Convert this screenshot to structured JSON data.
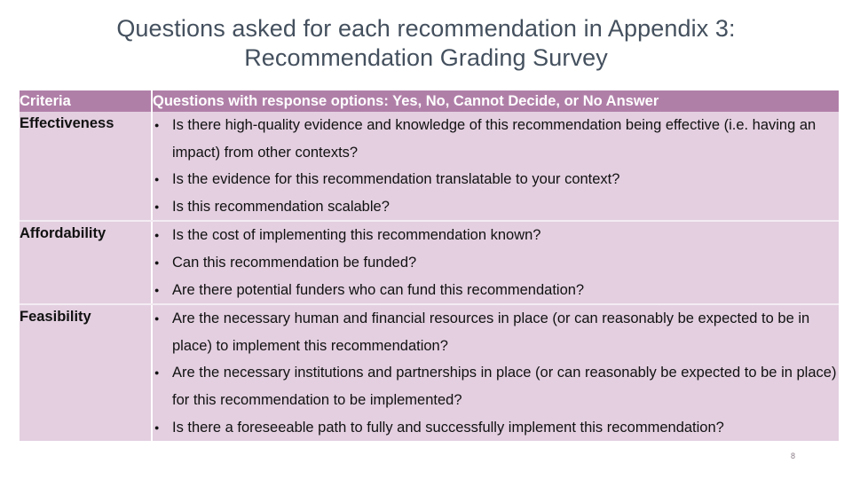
{
  "slide": {
    "title_line_1": "Questions asked for each recommendation in Appendix 3:",
    "title_line_2": "Recommendation Grading Survey",
    "page_number": "8",
    "accent_header_color": "#b07fa8",
    "body_cell_color": "#e3cfe0",
    "title_color": "#44505e"
  },
  "table": {
    "headers": {
      "criteria": "Criteria",
      "questions": "Questions with response options: Yes, No, Cannot Decide, or No Answer"
    },
    "rows": [
      {
        "criteria": "Effectiveness",
        "questions": [
          "Is there high-quality evidence and knowledge of this recommendation being effective (i.e. having an impact) from other contexts?",
          "Is the evidence for this recommendation translatable to your context?",
          "Is this recommendation scalable?"
        ]
      },
      {
        "criteria": "Affordability",
        "questions": [
          "Is the cost of implementing this recommendation known?",
          "Can this recommendation be funded?",
          "Are there potential funders who can fund this recommendation?"
        ]
      },
      {
        "criteria": "Feasibility",
        "questions": [
          "Are the necessary human and financial resources in place (or can reasonably be expected to be in place) to implement this recommendation?",
          "Are the necessary institutions and partnerships in place (or can reasonably be expected to be in place) for this recommendation to be implemented?",
          "Is there a foreseeable path to fully and successfully implement this recommendation?"
        ]
      }
    ]
  }
}
